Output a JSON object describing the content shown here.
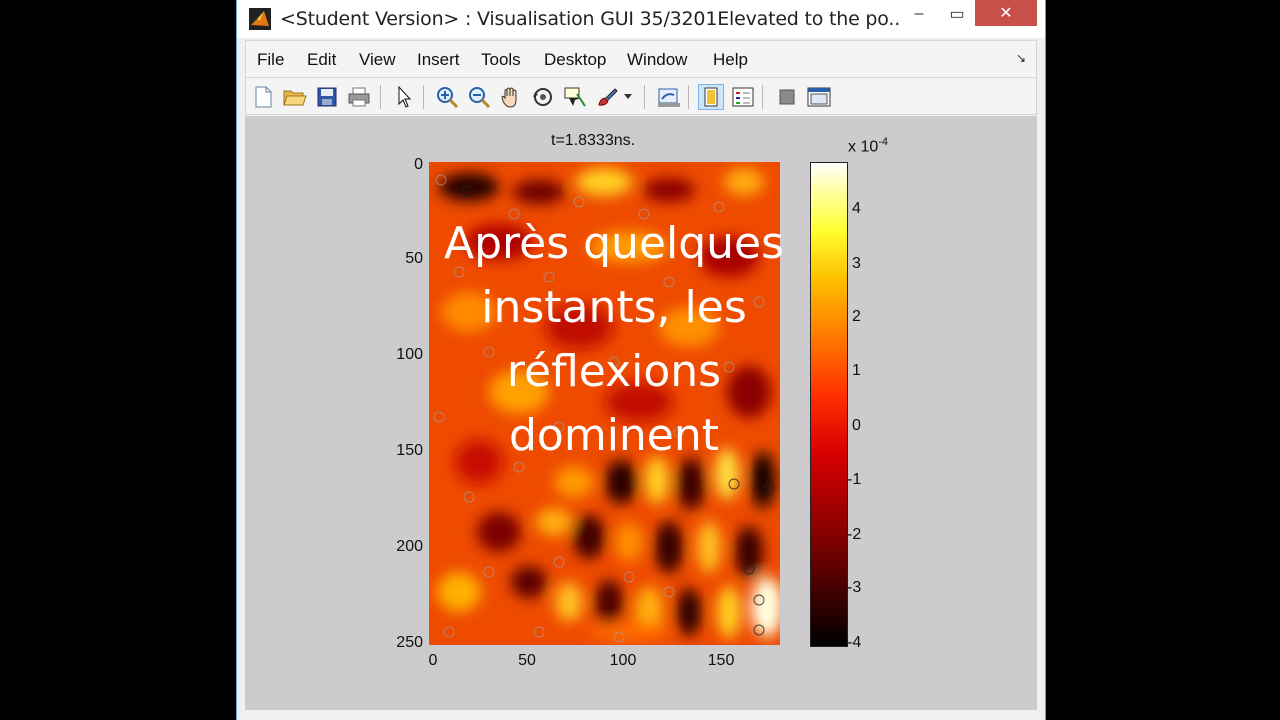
{
  "window": {
    "title": "<Student Version> : Visualisation GUI 35/3201Elevated to the po...",
    "controls": {
      "minimize": "‒",
      "maximize": "▭",
      "close": "✕"
    }
  },
  "menubar": {
    "items": [
      "File",
      "Edit",
      "View",
      "Insert",
      "Tools",
      "Desktop",
      "Window",
      "Help"
    ]
  },
  "toolbar": {
    "icons": [
      "new-figure-icon",
      "open-file-icon",
      "save-icon",
      "print-icon",
      "edit-plot-arrow-icon",
      "zoom-in-icon",
      "zoom-out-icon",
      "pan-hand-icon",
      "rotate-3d-icon",
      "data-cursor-icon",
      "brush-icon",
      "link-plot-icon",
      "insert-colorbar-icon",
      "insert-legend-icon",
      "hide-plot-tools-icon",
      "show-plot-tools-icon"
    ]
  },
  "plot": {
    "title": "t=1.8333ns.",
    "overlay_text_lines": [
      "Après quelques",
      "instants, les",
      "réflexions",
      "dominent"
    ],
    "y_ticks": [
      "0",
      "50",
      "100",
      "150",
      "200",
      "250"
    ],
    "x_ticks": [
      "0",
      "50",
      "100",
      "150"
    ],
    "colorbar": {
      "exponent_base": "x 10",
      "exponent_power": "-4",
      "ticks": [
        "4",
        "3",
        "2",
        "1",
        "0",
        "-1",
        "-2",
        "-3",
        "-4"
      ]
    }
  },
  "chart_data": {
    "type": "heatmap",
    "title": "t=1.8333ns.",
    "xlabel": "",
    "ylabel": "",
    "xlim": [
      0,
      183
    ],
    "ylim": [
      250,
      0
    ],
    "x_ticks": [
      0,
      50,
      100,
      150
    ],
    "y_ticks": [
      0,
      50,
      100,
      150,
      200,
      250
    ],
    "colormap": "hot",
    "clim": [
      -0.0004,
      0.0005
    ],
    "colorbar_ticks": [
      4,
      3,
      2,
      1,
      0,
      -1,
      -2,
      -3,
      -4
    ],
    "colorbar_scale": "x 10^-4"
  }
}
